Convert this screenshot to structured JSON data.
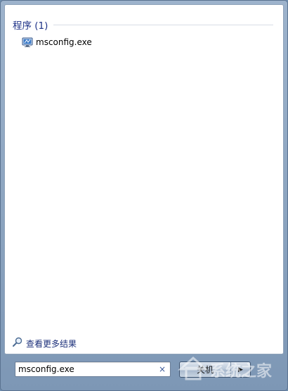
{
  "results": {
    "group_title": "程序 (1)",
    "items": [
      {
        "label": "msconfig.exe",
        "icon": "system-config-icon"
      }
    ]
  },
  "more_results": {
    "label": "查看更多结果",
    "icon": "magnifier-icon"
  },
  "search": {
    "value": "msconfig.exe",
    "clear_glyph": "×"
  },
  "shutdown": {
    "label": "关机",
    "arrow": "▶"
  },
  "watermark": {
    "text": "系统之家"
  },
  "colors": {
    "group_title": "#1e3287",
    "link": "#1b2f7a",
    "frame": "#7d97b5"
  }
}
